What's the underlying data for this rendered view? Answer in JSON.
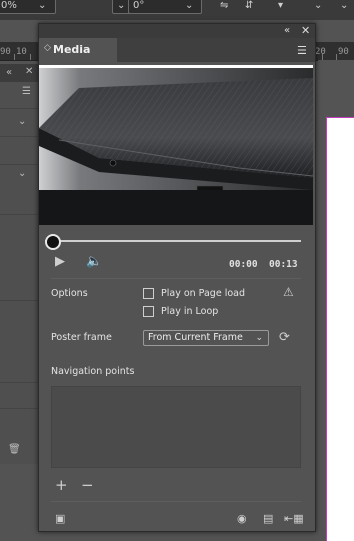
{
  "topbar": {
    "percent_value": "0%",
    "angle_value": "0°"
  },
  "ruler": {
    "labels": [
      "90",
      "10",
      "20",
      "90"
    ]
  },
  "media_panel": {
    "title": "Media",
    "time": {
      "current": "00:00",
      "duration": "00:13"
    },
    "playback_progress": 0.0,
    "options": {
      "label": "Options",
      "play_on_load": "Play on Page load",
      "play_in_loop": "Play in Loop"
    },
    "poster_frame": {
      "label": "Poster frame",
      "value": "From Current Frame"
    },
    "navigation": {
      "label": "Navigation points"
    }
  },
  "icons": {
    "play": "play-icon",
    "volume": "volume-icon",
    "warning": "warning-icon",
    "refresh": "refresh-icon",
    "add": "add-icon",
    "remove": "remove-icon",
    "web": "globe-icon",
    "pdf": "pdf-icon",
    "export": "export-icon",
    "video": "video-icon",
    "menu": "panel-menu-icon",
    "close": "close-icon"
  }
}
